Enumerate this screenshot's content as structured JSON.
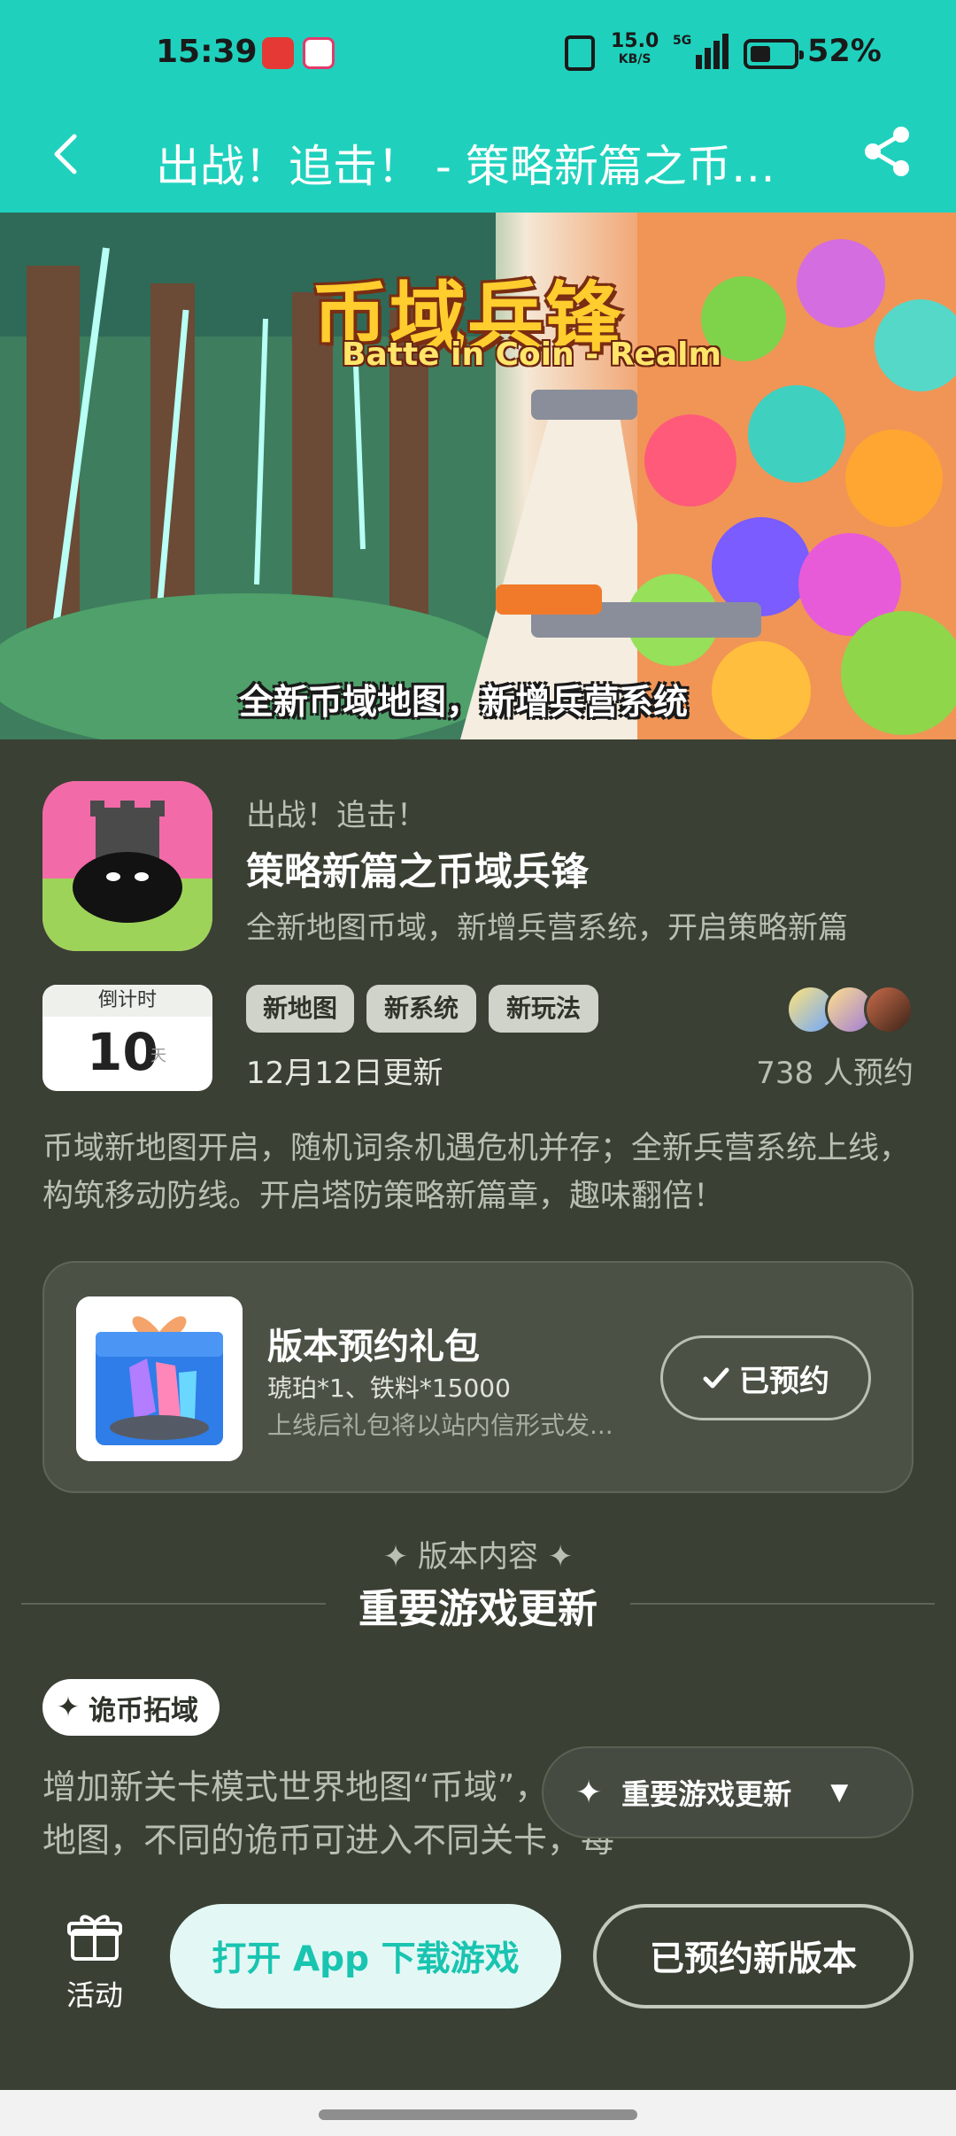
{
  "status_bar": {
    "time": "15:39",
    "net_speed": "15.0",
    "net_speed_unit": "KB/S",
    "network": "5G",
    "battery": "52%"
  },
  "header": {
    "title": "出战！追击！ - 策略新篇之币…",
    "accent_color": "#1fd1bd"
  },
  "banner": {
    "logo_text": "币域兵锋",
    "logo_subtext": "Batte in Coin - Realm",
    "caption": "全新币域地图，新增兵营系统"
  },
  "game": {
    "pre_title": "出战！追击！",
    "title": "策略新篇之币域兵锋",
    "subtitle": "全新地图币域，新增兵营系统，开启策略新篇",
    "countdown_label": "倒计时",
    "countdown_value": "10",
    "countdown_unit": "天",
    "tags": [
      "新地图",
      "新系统",
      "新玩法"
    ],
    "update_date": "12月12日更新",
    "reserve_count": "738 人预约",
    "description": "币域新地图开启，随机词条机遇危机并存；全新兵营系统上线，构筑移动防线。开启塔防策略新篇章，趣味翻倍！"
  },
  "gift": {
    "title": "版本预约礼包",
    "items": "琥珀*1、铁料*15000",
    "note": "上线后礼包将以站内信形式发...",
    "button_label": "已预约"
  },
  "section": {
    "kicker": "版本内容",
    "title": "重要游戏更新",
    "badge": "诡币拓域",
    "body": "增加新关卡模式世界地图“币域”，玩家可以进入“币域”新地图，不同的诡币可进入不同关卡，每"
  },
  "floating_chip": {
    "label": "重要游戏更新"
  },
  "bottom_bar": {
    "activity_label": "活动",
    "open_app_label": "打开 App 下载游戏",
    "reserved_version_label": "已预约新版本"
  }
}
